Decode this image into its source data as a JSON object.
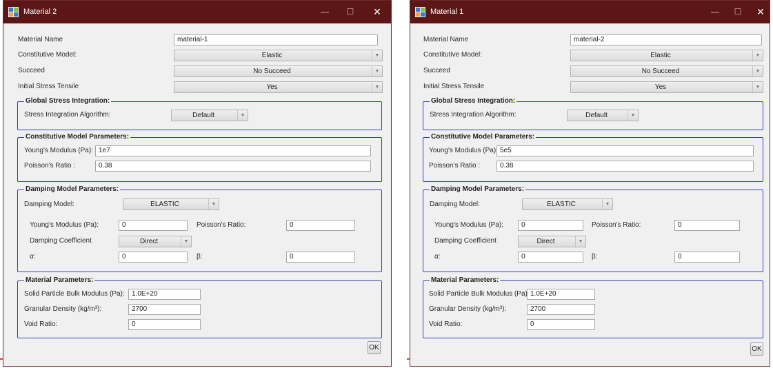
{
  "windows": [
    {
      "title": "Material 2",
      "material_name_label": "Material Name",
      "material_name_value": "material-1",
      "constitutive_model_label": "Constitutive Model:",
      "constitutive_model_value": "Elastic",
      "succeed_label": "Succeed",
      "succeed_value": "No Succeed",
      "initial_stress_label": "Initial Stress Tensile",
      "initial_stress_value": "Yes",
      "global_group_title": "Global Stress Integration:",
      "algorithm_label": "Stress Integration Algorithm:",
      "algorithm_value": "Default",
      "cmp_group_title": "Constitutive Model Parameters:",
      "youngs_label": "Young's Modulus (Pa):",
      "youngs_value": "1e7",
      "poisson_label": "Poisson's Ratio :",
      "poisson_value": "0.38",
      "damping_group_title": "Damping Model Parameters:",
      "damping_model_label": "Damping Model:",
      "damping_model_value": "ELASTIC",
      "d_youngs_label": "Young's Modulus (Pa):",
      "d_youngs_value": "0",
      "d_poisson_label": "Poisson's Ratio:",
      "d_poisson_value": "0",
      "damping_coeff_label": "Damping Coefficient",
      "damping_coeff_value": "Direct",
      "alpha_label": "α:",
      "alpha_value": "0",
      "beta_label": "β:",
      "beta_value": "0",
      "mat_group_title": "Material Parameters:",
      "bulk_label": "Solid Particle Bulk Modulus (Pa):",
      "bulk_value": "1.0E+20",
      "density_label": "Granular Density (kg/m³):",
      "density_value": "2700",
      "void_label": "Void Ratio:",
      "void_value": "0",
      "ok_label": "OK"
    },
    {
      "title": "Material 1",
      "material_name_label": "Material Name",
      "material_name_value": "material-2",
      "constitutive_model_label": "Constitutive Model:",
      "constitutive_model_value": "Elastic",
      "succeed_label": "Succeed",
      "succeed_value": "No Succeed",
      "initial_stress_label": "Initial Stress Tensile",
      "initial_stress_value": "Yes",
      "global_group_title": "Global Stress Integration:",
      "algorithm_label": "Stress Integration Algorithm:",
      "algorithm_value": "Default",
      "cmp_group_title": "Constitutive Model Parameters:",
      "youngs_label": "Young's Modulus (Pa):",
      "youngs_value": "5e5",
      "poisson_label": "Poisson's Ratio :",
      "poisson_value": "0.38",
      "damping_group_title": "Damping Model Parameters:",
      "damping_model_label": "Damping Model:",
      "damping_model_value": "ELASTIC",
      "d_youngs_label": "Young's Modulus (Pa):",
      "d_youngs_value": "0",
      "d_poisson_label": "Poisson's Ratio:",
      "d_poisson_value": "0",
      "damping_coeff_label": "Damping Coefficient",
      "damping_coeff_value": "Direct",
      "alpha_label": "α:",
      "alpha_value": "0",
      "beta_label": "β:",
      "beta_value": "0",
      "mat_group_title": "Material Parameters:",
      "bulk_label": "Solid Particle Bulk Modulus (Pa):",
      "bulk_value": "1.0E+20",
      "density_label": "Granular Density (kg/m³):",
      "density_value": "2700",
      "void_label": "Void Ratio:",
      "void_value": "0",
      "ok_label": "OK"
    }
  ],
  "icons": {
    "minimize": "minimize-icon",
    "maximize": "maximize-icon",
    "close": "close-icon",
    "dropdown": "chevron-down-icon",
    "app": "app-icon"
  },
  "colors": {
    "titlebar": "#5c1616",
    "group_border": "#2b3fc4",
    "window_bg": "#f0f0f0"
  }
}
